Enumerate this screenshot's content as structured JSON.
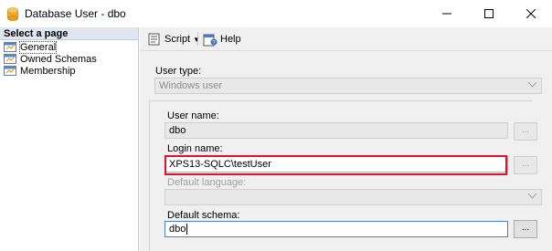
{
  "window": {
    "title": "Database User - dbo",
    "controls": {
      "minimize": "minimize",
      "maximize": "maximize",
      "close": "close"
    }
  },
  "left_pane": {
    "header": "Select a page",
    "items": [
      {
        "label": "General",
        "selected": true
      },
      {
        "label": "Owned Schemas",
        "selected": false
      },
      {
        "label": "Membership",
        "selected": false
      }
    ]
  },
  "toolbar": {
    "script_label": "Script",
    "help_label": "Help"
  },
  "form": {
    "user_type_label": "User type:",
    "user_type_value": "Windows user",
    "user_name_label": "User name:",
    "user_name_value": "dbo",
    "login_name_label": "Login name:",
    "login_name_value": "XPS13-SQLC\\testUser",
    "default_language_label": "Default language:",
    "default_language_value": "",
    "default_schema_label": "Default schema:",
    "default_schema_value": "dbo",
    "browse_label": "..."
  },
  "colors": {
    "highlight": "#e3102c",
    "header_bg": "#dfe6f0",
    "pane_bg": "#f0f0f0",
    "focus_border": "#4a7fc1"
  }
}
